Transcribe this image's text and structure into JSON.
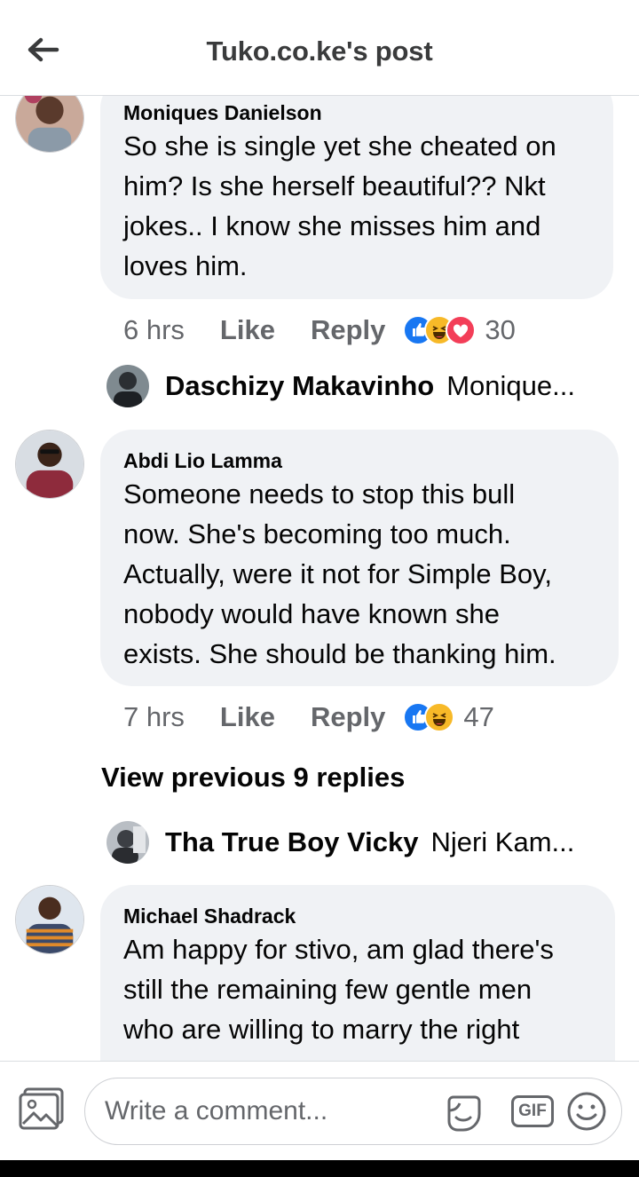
{
  "header": {
    "title": "Tuko.co.ke's post"
  },
  "comments": [
    {
      "author": "Moniques Danielson",
      "lines": [
        "So she is single yet she cheated on",
        "him? Is she herself beautiful?? Nkt",
        "jokes.. I know she misses him and",
        "loves him."
      ],
      "time": "6 hrs",
      "like": "Like",
      "reply": "Reply",
      "reaction_count": "30",
      "reactions": [
        "like",
        "haha",
        "love"
      ]
    },
    {
      "author": "Abdi Lio Lamma",
      "lines": [
        "Someone needs to stop this bull",
        "now. She's becoming too much.",
        "Actually, were it not for Simple Boy,",
        "nobody would have known she",
        "exists. She should be thanking him."
      ],
      "time": "7 hrs",
      "like": "Like",
      "reply": "Reply",
      "reaction_count": "47",
      "reactions": [
        "like",
        "haha"
      ]
    },
    {
      "author": "Michael Shadrack",
      "lines": [
        "Am happy for stivo, am glad there's",
        "still the remaining few gentle men",
        "who are willing to  marry the right"
      ]
    }
  ],
  "reply_previews": [
    {
      "name": "Daschizy Makavinho",
      "snippet": "Monique..."
    },
    {
      "name": "Tha True Boy Vicky",
      "snippet": "Njeri Kam..."
    }
  ],
  "view_previous": "View previous 9 replies",
  "composer": {
    "placeholder": "Write a comment...",
    "gif_label": "GIF"
  },
  "colors": {
    "like_blue": "#1877f2",
    "haha_yellow": "#f7b928",
    "love_red": "#f33e58",
    "bubble_gray": "#f0f2f5",
    "secondary_text": "#65676b"
  }
}
